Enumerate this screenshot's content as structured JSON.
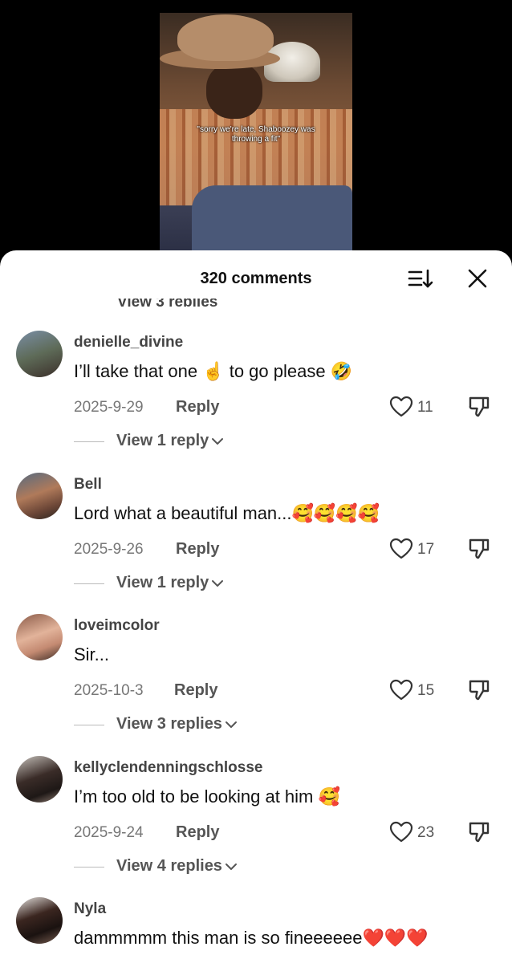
{
  "video": {
    "caption": "\"sorry we're late, Shaboozey was throwing a fit\""
  },
  "header": {
    "comment_count": "320 comments",
    "cut_text": "View 3 replies"
  },
  "comments": [
    {
      "username": "denielle_divine",
      "text": "I’ll take that one ☝️ to go please 🤣",
      "date": "2025-9-29",
      "reply_label": "Reply",
      "likes": "11",
      "view_replies": "View 1 reply"
    },
    {
      "username": "Bell",
      "text": "Lord what a beautiful man...🥰🥰🥰🥰",
      "date": "2025-9-26",
      "reply_label": "Reply",
      "likes": "17",
      "view_replies": "View 1 reply"
    },
    {
      "username": "loveimcolor",
      "text": "Sir...",
      "date": "2025-10-3",
      "reply_label": "Reply",
      "likes": "15",
      "view_replies": "View 3 replies"
    },
    {
      "username": "kellyclendenningschlosse",
      "text": "I’m too old to be looking at him 🥰",
      "date": "2025-9-24",
      "reply_label": "Reply",
      "likes": "23",
      "view_replies": "View 4 replies"
    },
    {
      "username": "Nyla",
      "text": "dammmmm this man is so fineeeeee❤️❤️❤️"
    }
  ],
  "icons": {
    "sort": "sort-icon",
    "close": "close-icon",
    "like": "heart-icon",
    "dislike": "thumbs-down-icon",
    "chevron": "chevron-down-icon"
  }
}
